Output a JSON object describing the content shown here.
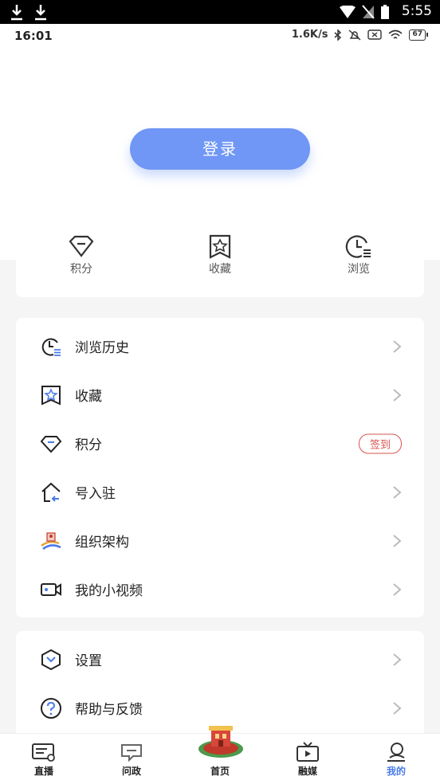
{
  "system_bar": {
    "time": "5:55"
  },
  "app_status": {
    "time": "16:01",
    "net_speed": "1.6K/s",
    "battery": "67"
  },
  "header": {
    "login_label": "登录"
  },
  "quick": [
    {
      "label": "积分",
      "icon": "diamond-icon"
    },
    {
      "label": "收藏",
      "icon": "star-bookmark-icon"
    },
    {
      "label": "浏览",
      "icon": "clock-list-icon"
    }
  ],
  "menu1": [
    {
      "label": "浏览历史",
      "icon": "history-icon"
    },
    {
      "label": "收藏",
      "icon": "favorite-icon"
    },
    {
      "label": "积分",
      "icon": "points-icon",
      "badge": "签到"
    },
    {
      "label": "号入驻",
      "icon": "house-icon"
    },
    {
      "label": "组织架构",
      "icon": "org-icon"
    },
    {
      "label": "我的小视频",
      "icon": "video-camera-icon"
    }
  ],
  "menu2": [
    {
      "label": "设置",
      "icon": "settings-icon"
    },
    {
      "label": "帮助与反馈",
      "icon": "help-icon"
    }
  ],
  "tabs": [
    {
      "label": "直播",
      "icon": "live-icon"
    },
    {
      "label": "问政",
      "icon": "chat-icon"
    },
    {
      "label": "首页",
      "icon": "home-logo-icon"
    },
    {
      "label": "融媒",
      "icon": "tv-icon"
    },
    {
      "label": "我的",
      "icon": "profile-icon",
      "active": true
    }
  ],
  "colors": {
    "accent": "#7097f5",
    "active_tab": "#4a7be8",
    "badge": "#d9534f"
  }
}
